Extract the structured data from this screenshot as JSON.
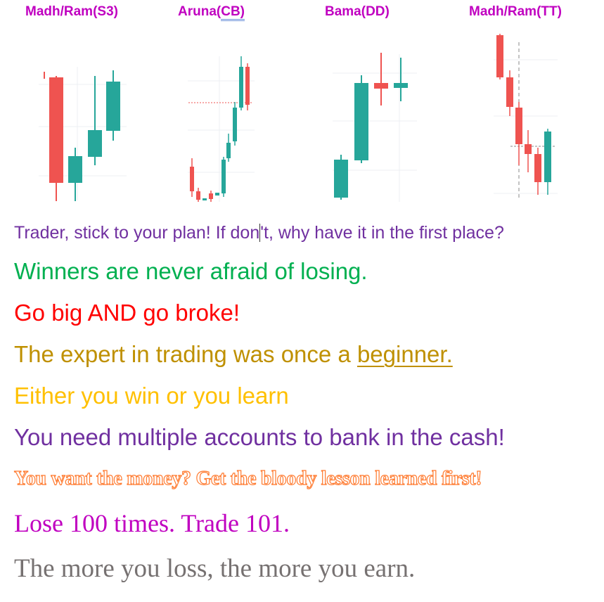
{
  "charts": [
    {
      "title": "Madh/Ram(S3)"
    },
    {
      "title_prefix": "Aruna(",
      "title_underlined": "CB)",
      "title_suffix": ""
    },
    {
      "title": "Bama(DD)"
    },
    {
      "title": "Madh/Ram(TT)"
    }
  ],
  "colors": {
    "bull": "#26a69a",
    "bear": "#ef5350",
    "title": "#c000c0"
  },
  "quotes": [
    {
      "pre": "Trader, stick to your plan! If don",
      "post": "'t, why have it in the first place?",
      "color": "#7030a0"
    },
    {
      "text": "Winners are never afraid of losing.",
      "color": "#00b050"
    },
    {
      "text": "Go big AND go broke!",
      "color": "#ff0000"
    },
    {
      "pre": "The expert in trading was once a ",
      "underlined": "beginner.",
      "color": "#bf9000"
    },
    {
      "text": "Either you win or you learn",
      "color": "#ffc000"
    },
    {
      "text": "You need multiple accounts to bank in the cash!",
      "color": "#7030a0"
    },
    {
      "text": "You want the money? Get the bloody lesson learned first!",
      "color": "#ff7a2f"
    },
    {
      "text": "Lose 100 times. Trade 101.",
      "color": "#c000c0"
    },
    {
      "text": "The more you loss, the more you earn.",
      "color": "#767171"
    }
  ]
}
